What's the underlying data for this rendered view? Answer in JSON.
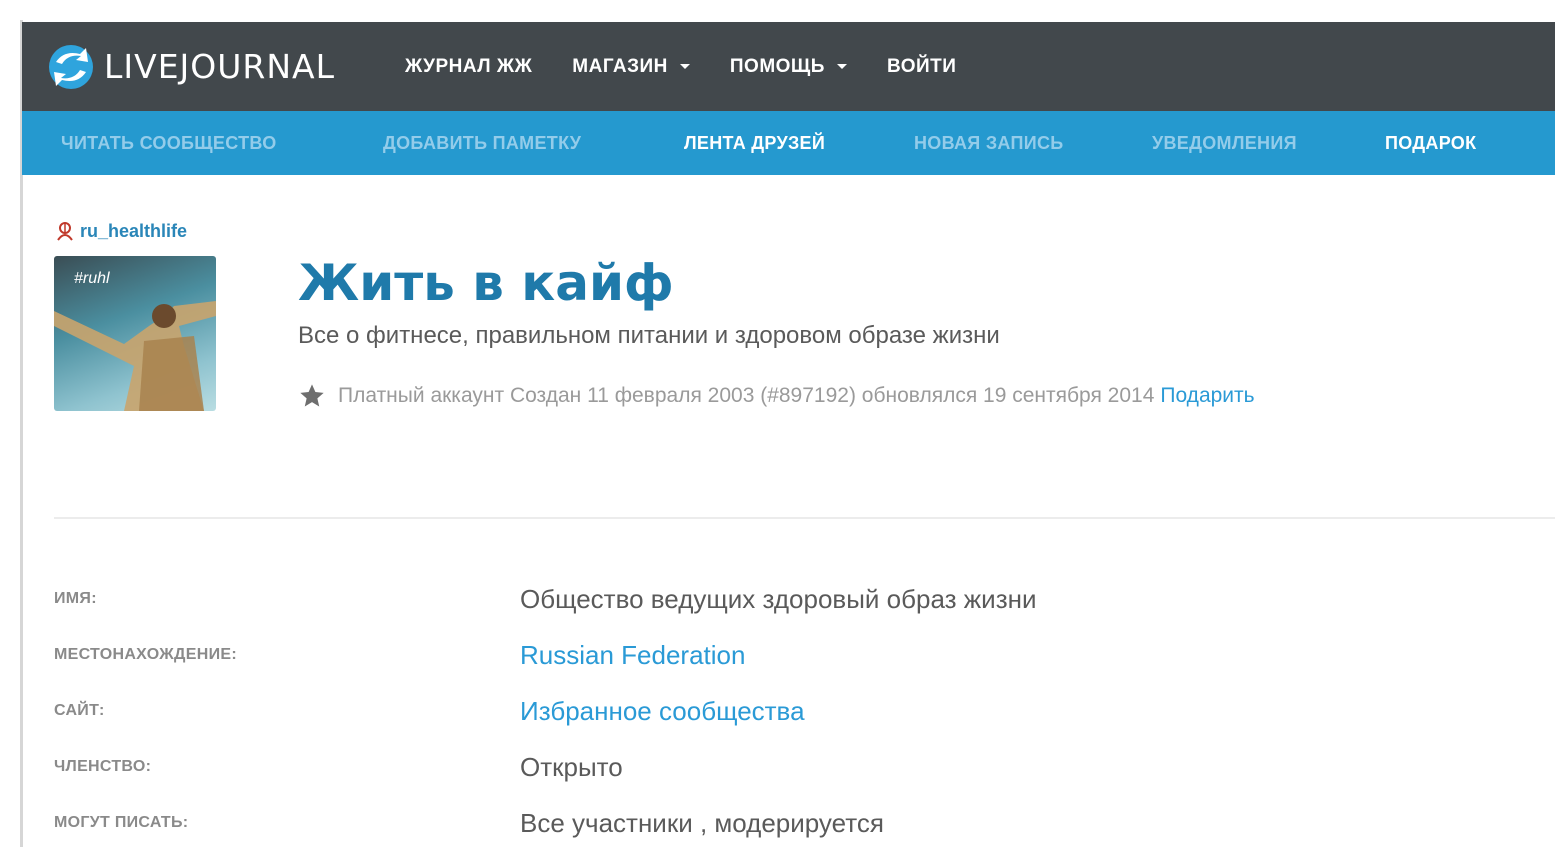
{
  "header": {
    "logo_text": "LIVEJOURNAL",
    "nav": [
      {
        "label": "ЖУРНАЛ ЖЖ"
      },
      {
        "label": "МАГАЗИН"
      },
      {
        "label": "ПОМОЩЬ"
      },
      {
        "label": "ВОЙТИ"
      }
    ]
  },
  "subnav": {
    "items": [
      {
        "label": "ЧИТАТЬ СООБЩЕСТВО"
      },
      {
        "label": "ДОБАВИТЬ ПАМЕТКУ"
      },
      {
        "label": "ЛЕНТА ДРУЗЕЙ"
      },
      {
        "label": "НОВАЯ ЗАПИСЬ"
      },
      {
        "label": "УВЕДОМЛЕНИЯ"
      },
      {
        "label": "ПОДАРОК"
      }
    ]
  },
  "profile": {
    "username": "ru_healthlife",
    "avatar_tag": "#ruhl",
    "title": "Жить в кайф",
    "subtitle": "Все о фитнесе, правильном питании и здоровом образе жизни",
    "meta_text": "Платный аккаунт Создан 11 февраля 2003 (#897192) обновлялся 19 сентября 2014",
    "gift_link": "Подарить"
  },
  "info": {
    "rows": [
      {
        "label": "ИМЯ:",
        "value": "Общество ведущих здоровый образ жизни"
      },
      {
        "label": "МЕСТОНАХОЖДЕНИЕ:",
        "value": "Russian Federation"
      },
      {
        "label": "САЙТ:",
        "value": "Избранное сообщества"
      },
      {
        "label": "ЧЛЕНСТВО:",
        "value": "Открыто"
      },
      {
        "label": "МОГУТ ПИСАТЬ:",
        "value": "Все участники , модерируется"
      }
    ]
  },
  "colors": {
    "topbar": "#42484c",
    "subnav": "#2599cf",
    "title": "#1f7aaa",
    "link": "#2a9ad6"
  }
}
